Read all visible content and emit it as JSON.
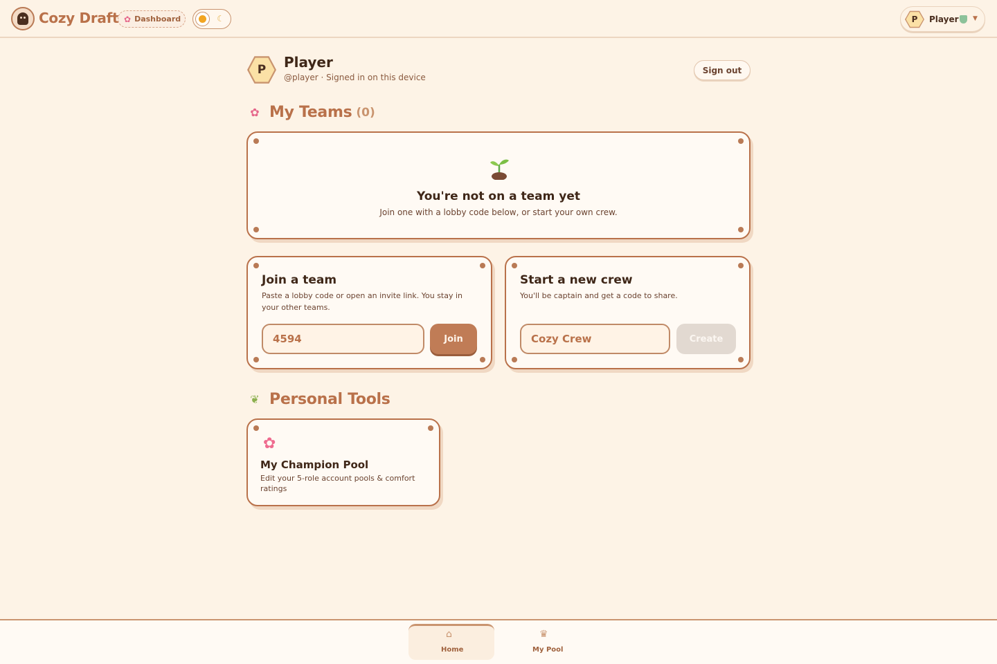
{
  "header": {
    "brand": "Cozy Draft",
    "dashboard_chip": "Dashboard",
    "user_chip": {
      "initial": "P",
      "name": "Player"
    }
  },
  "profile": {
    "initial": "P",
    "name": "Player",
    "subtitle": "@player · Signed in on this device",
    "sign_out_label": "Sign out"
  },
  "my_teams": {
    "title": "My Teams",
    "count": "(0)",
    "empty_title": "You're not on a team yet",
    "empty_subtitle": "Join one with a lobby code below, or start your own crew."
  },
  "join_team": {
    "title": "Join a team",
    "description": "Paste a lobby code or open an invite link. You stay in your other teams.",
    "input_value": "4594",
    "button_label": "Join"
  },
  "new_crew": {
    "title": "Start a new crew",
    "description": "You'll be captain and get a code to share.",
    "input_placeholder": "Cozy Crew",
    "button_label": "Create"
  },
  "personal_tools": {
    "title": "Personal Tools",
    "tools": [
      {
        "title": "My Champion Pool",
        "description": "Edit your 5-role account pools & comfort ratings"
      }
    ]
  },
  "bottom_nav": {
    "items": [
      {
        "label": "Home",
        "icon": "home-icon",
        "active": true
      },
      {
        "label": "My Pool",
        "icon": "trophy-icon",
        "active": false
      }
    ]
  },
  "colors": {
    "accent": "#b9714a",
    "background": "#fdf3e6",
    "card": "#fffaf4"
  }
}
